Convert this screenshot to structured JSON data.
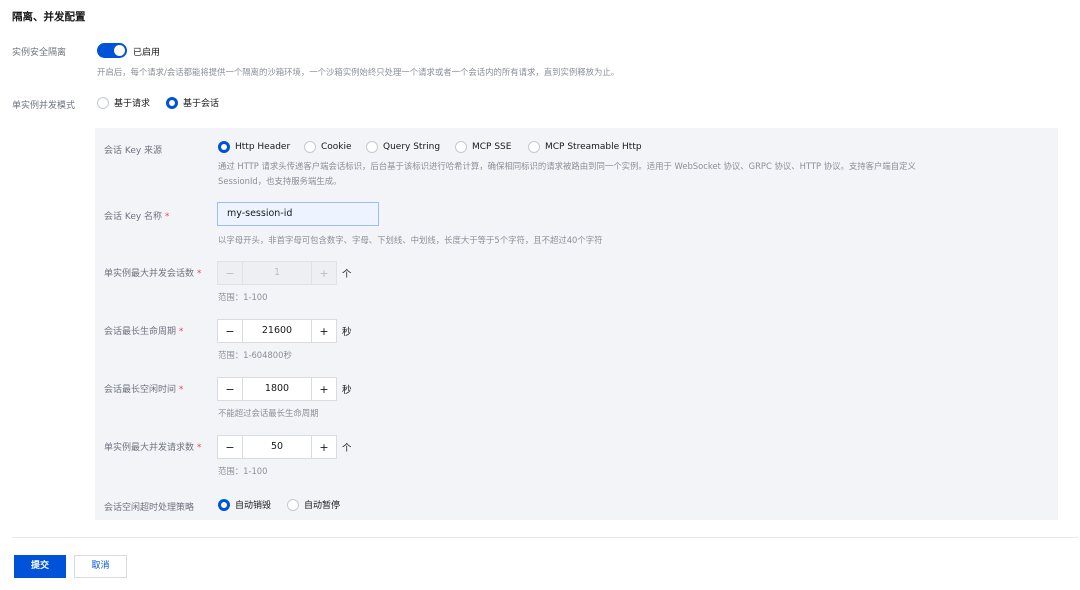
{
  "section": {
    "title": "隔离、并发配置"
  },
  "isolation": {
    "label": "实例安全隔离",
    "switch_text": "已启用",
    "hint": "开启后，每个请求/会话都能将提供一个隔离的沙箱环境，一个沙箱实例始终只处理一个请求或者一个会话内的所有请求，直到实例释放为止。"
  },
  "concurrency_mode": {
    "label": "单实例并发模式",
    "options": [
      {
        "text": "基于请求",
        "selected": false
      },
      {
        "text": "基于会话",
        "selected": true
      }
    ]
  },
  "session_key_source": {
    "label": "会话 Key 来源",
    "options": [
      {
        "text": "Http Header",
        "selected": true
      },
      {
        "text": "Cookie",
        "selected": false
      },
      {
        "text": "Query String",
        "selected": false
      },
      {
        "text": "MCP SSE",
        "selected": false
      },
      {
        "text": "MCP Streamable Http",
        "selected": false
      }
    ],
    "hint_line1": "通过 HTTP 请求头传递客户端会话标识，后台基于该标识进行哈希计算，确保相同标识的请求被路由到同一个实例。适用于 WebSocket 协议、GRPC 协议、HTTP 协议。支持客户端自定义",
    "hint_line2": "SessionId，也支持服务端生成。"
  },
  "session_key_name": {
    "label": "会话 Key 名称",
    "required_mark": "*",
    "value": "my-session-id",
    "hint": "以字母开头，非首字母可包含数字、字母、下划线、中划线，长度大于等于5个字符，且不超过40个字符"
  },
  "max_sessions": {
    "label": "单实例最大并发会话数",
    "required_mark": "*",
    "minus": "−",
    "plus": "+",
    "value": "1",
    "unit": "个",
    "hint": "范围：1-100",
    "disabled": true
  },
  "max_lifetime": {
    "label": "会话最长生命周期",
    "required_mark": "*",
    "minus": "−",
    "plus": "+",
    "value": "21600",
    "unit": "秒",
    "hint": "范围：1-604800秒"
  },
  "max_idle": {
    "label": "会话最长空闲时间",
    "required_mark": "*",
    "minus": "−",
    "plus": "+",
    "value": "1800",
    "unit": "秒",
    "hint": "不能超过会话最长生命周期"
  },
  "max_requests": {
    "label": "单实例最大并发请求数",
    "required_mark": "*",
    "minus": "−",
    "plus": "+",
    "value": "50",
    "unit": "个",
    "hint": "范围：1-100"
  },
  "idle_timeout_policy": {
    "label": "会话空闲超时处理策略",
    "options": [
      {
        "text": "自动销毁",
        "selected": true
      },
      {
        "text": "自动暂停",
        "selected": false
      }
    ]
  },
  "actions": {
    "submit": "提交",
    "cancel": "取消"
  },
  "colors": {
    "primary": "#0052d9",
    "required": "#e34d59",
    "panel_bg": "#f3f4f7"
  }
}
